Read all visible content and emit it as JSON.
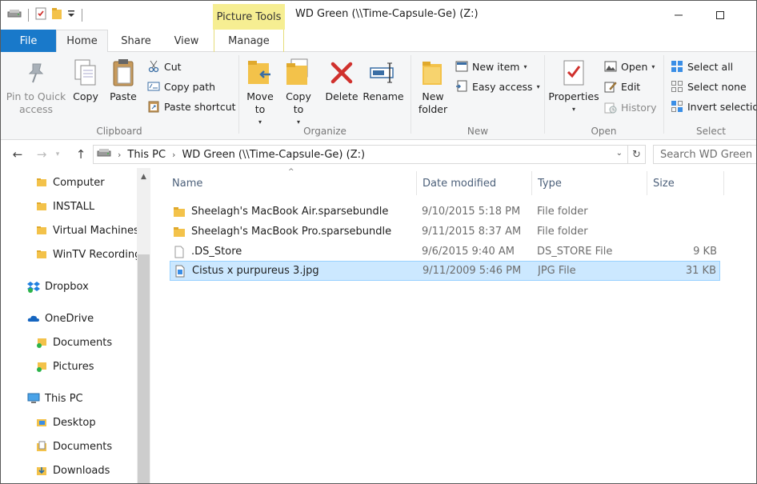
{
  "window": {
    "title": "WD Green (\\\\Time-Capsule-Ge) (Z:)",
    "context_tab": "Picture Tools"
  },
  "tabs": {
    "file": "File",
    "home": "Home",
    "share": "Share",
    "view": "View",
    "manage": "Manage"
  },
  "ribbon": {
    "clipboard": {
      "label": "Clipboard",
      "pin": "Pin to Quick access",
      "copy": "Copy",
      "paste": "Paste",
      "cut": "Cut",
      "copy_path": "Copy path",
      "paste_shortcut": "Paste shortcut"
    },
    "organize": {
      "label": "Organize",
      "move_to": "Move to",
      "copy_to": "Copy to",
      "delete": "Delete",
      "rename": "Rename"
    },
    "new": {
      "label": "New",
      "new_folder": "New folder",
      "new_item": "New item",
      "easy_access": "Easy access"
    },
    "open": {
      "label": "Open",
      "properties": "Properties",
      "open": "Open",
      "edit": "Edit",
      "history": "History"
    },
    "select": {
      "label": "Select",
      "select_all": "Select all",
      "select_none": "Select none",
      "invert": "Invert selection"
    }
  },
  "address": {
    "this_pc": "This PC",
    "location": "WD Green (\\\\Time-Capsule-Ge) (Z:)",
    "search_placeholder": "Search WD Green ..."
  },
  "nav": [
    {
      "label": "Computer",
      "icon": "folder-icon"
    },
    {
      "label": "INSTALL",
      "icon": "folder-icon"
    },
    {
      "label": "Virtual Machines",
      "icon": "folder-icon"
    },
    {
      "label": "WinTV Recording",
      "icon": "folder-icon"
    },
    {
      "label": "Dropbox",
      "icon": "dropbox-icon"
    },
    {
      "label": "OneDrive",
      "icon": "onedrive-icon"
    },
    {
      "label": "Documents",
      "icon": "synced-folder-icon"
    },
    {
      "label": "Pictures",
      "icon": "synced-folder-icon"
    },
    {
      "label": "This PC",
      "icon": "this-pc-icon"
    },
    {
      "label": "Desktop",
      "icon": "desktop-folder-icon"
    },
    {
      "label": "Documents",
      "icon": "documents-folder-icon"
    },
    {
      "label": "Downloads",
      "icon": "downloads-folder-icon"
    }
  ],
  "columns": {
    "name": "Name",
    "date": "Date modified",
    "type": "Type",
    "size": "Size"
  },
  "files": [
    {
      "name": "Sheelagh's MacBook Air.sparsebundle",
      "date": "9/10/2015 5:18 PM",
      "type": "File folder",
      "size": "",
      "icon": "folder-icon",
      "selected": false
    },
    {
      "name": "Sheelagh's MacBook Pro.sparsebundle",
      "date": "9/11/2015 8:37 AM",
      "type": "File folder",
      "size": "",
      "icon": "folder-icon",
      "selected": false
    },
    {
      "name": ".DS_Store",
      "date": "9/6/2015 9:40 AM",
      "type": "DS_STORE File",
      "size": "9 KB",
      "icon": "file-icon",
      "selected": false
    },
    {
      "name": "Cistus x purpureus 3.jpg",
      "date": "9/11/2009 5:46 PM",
      "type": "JPG File",
      "size": "31 KB",
      "icon": "image-file-icon",
      "selected": true
    }
  ],
  "colors": {
    "file_tab": "#1979ca",
    "picture_tools": "#f6ee92",
    "selection": "#cce8ff",
    "selection_border": "#99d1ff",
    "folder": "#f3c24a"
  }
}
